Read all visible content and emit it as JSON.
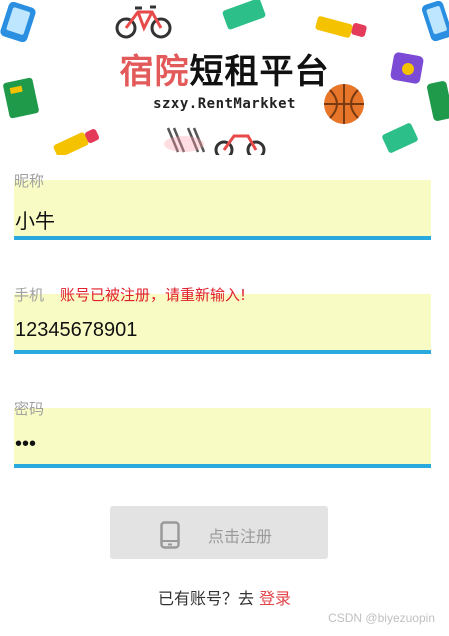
{
  "banner": {
    "title_red": "宿院",
    "title_black": "短租平台",
    "subtitle": "szxy.RentMarkket"
  },
  "form": {
    "nickname": {
      "label": "昵称",
      "value": "小牛"
    },
    "phone": {
      "label": "手机",
      "value": "12345678901",
      "error": "账号已被注册，请重新输入!"
    },
    "password": {
      "label": "密码",
      "value": "•••"
    }
  },
  "submit": {
    "label": "点击注册",
    "icon": "phone-icon"
  },
  "footer": {
    "prompt": "已有账号？去",
    "login_link": "登录",
    "watermark": "CSDN @biyezuopin"
  },
  "colors": {
    "accent_red": "#e35a5a",
    "error_red": "#e0202a",
    "field_bg": "#f8fcc4",
    "underline": "#2aa9de",
    "button_bg": "#e3e3e3"
  }
}
